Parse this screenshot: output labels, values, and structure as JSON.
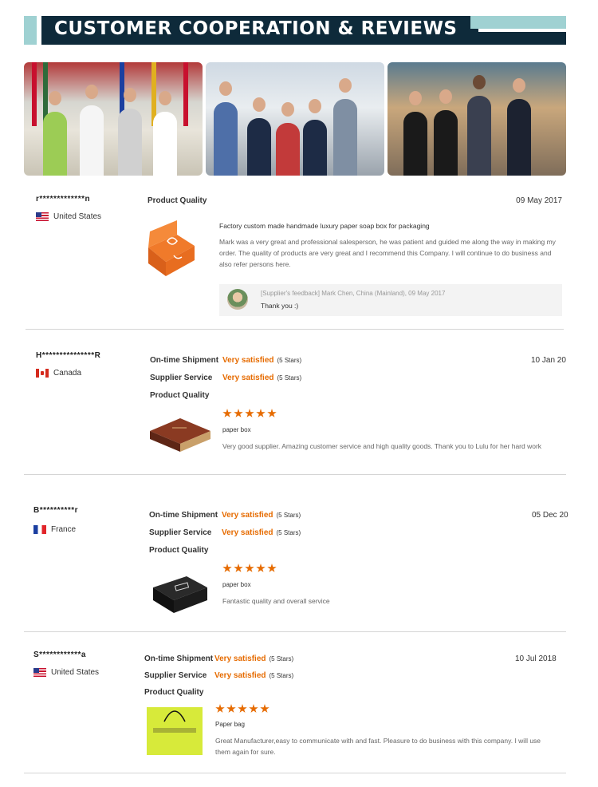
{
  "header": {
    "title": "CUSTOMER COOPERATION & REVIEWS"
  },
  "colors": {
    "banner_dark": "#0e2a3a",
    "banner_teal": "#9fd1d2",
    "rating_orange": "#e66b00"
  },
  "reviews": [
    {
      "reviewer": "r*************n",
      "country": "United States",
      "flag_icon": "us-flag-icon",
      "ratings": [
        {
          "label": "Product Quality",
          "value": "",
          "stars_note": ""
        }
      ],
      "date": "09 May 2017",
      "product": "Factory custom made handmade luxury paper soap box for packaging",
      "comment": "Mark was a very great and professional salesperson, he was patient and guided me along the way in making my order. The quality of products are very great and I recommend this Company. I will continue to do business and also refer persons here.",
      "feedback": {
        "meta": "[Supplier's feedback] Mark Chen, China (Mainland), 09 May 2017",
        "text": "Thank you :)"
      }
    },
    {
      "reviewer": "H***************R",
      "country": "Canada",
      "flag_icon": "canada-flag-icon",
      "ratings": [
        {
          "label": "On-time Shipment",
          "value": "Very satisfied",
          "stars_note": "(5 Stars)"
        },
        {
          "label": "Supplier Service",
          "value": "Very satisfied",
          "stars_note": "(5 Stars)"
        },
        {
          "label": "Product Quality",
          "value": "",
          "stars_note": ""
        }
      ],
      "star_count": 5,
      "date": "10 Jan 20",
      "product": "paper box",
      "comment": "Very good supplier. Amazing customer service and high quality goods. Thank you to Lulu for her hard work"
    },
    {
      "reviewer": "B**********r",
      "country": "France",
      "flag_icon": "france-flag-icon",
      "ratings": [
        {
          "label": "On-time Shipment",
          "value": "Very satisfied",
          "stars_note": "(5 Stars)"
        },
        {
          "label": "Supplier Service",
          "value": "Very satisfied",
          "stars_note": "(5 Stars)"
        },
        {
          "label": "Product Quality",
          "value": "",
          "stars_note": ""
        }
      ],
      "star_count": 5,
      "date": "05 Dec 20",
      "product": "paper box",
      "comment": "Fantastic quality and overall service"
    },
    {
      "reviewer": "S************a",
      "country": "United States",
      "flag_icon": "us-flag-icon",
      "ratings": [
        {
          "label": "On-time Shipment",
          "value": "Very satisfied",
          "stars_note": "(5 Stars)"
        },
        {
          "label": "Supplier Service",
          "value": "Very satisfied",
          "stars_note": "(5 Stars)"
        },
        {
          "label": "Product Quality",
          "value": "",
          "stars_note": ""
        }
      ],
      "star_count": 5,
      "date": "10 Jul 2018",
      "product": "Paper bag",
      "comment": "Great Manufacturer,easy to communicate with and fast. Pleasure to do business with this company. I will use them again for sure."
    }
  ]
}
